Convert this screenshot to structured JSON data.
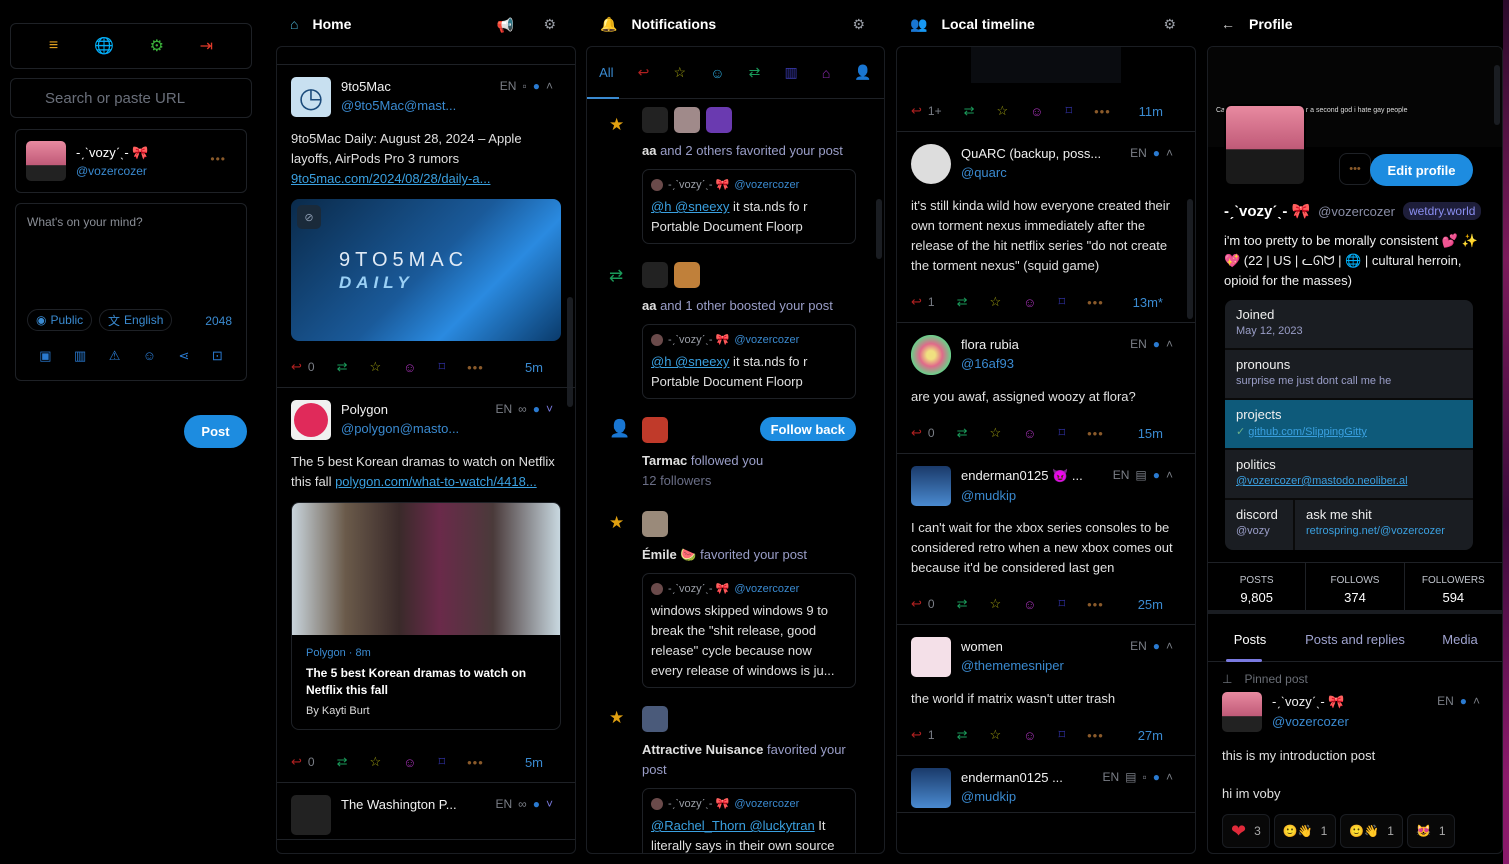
{
  "sidebar": {
    "nav_icons": [
      "menu-icon",
      "globe-icon",
      "settings-icon",
      "logout-icon"
    ],
    "search_placeholder": "Search or paste URL",
    "account": {
      "display_name": "-ˏˋvozyˊˎ- 🎀",
      "handle": "@vozercozer"
    },
    "compose": {
      "placeholder": "What's on your mind?",
      "visibility": "Public",
      "language": "English",
      "char_count": "2048",
      "tool_icons": [
        "media-icon",
        "poll-icon",
        "content-warning-icon",
        "emoji-icon",
        "share-icon",
        "schedule-icon"
      ],
      "post_label": "Post"
    }
  },
  "home": {
    "title": "Home",
    "statuses": [
      {
        "name": "9to5Mac",
        "handle": "@9to5Mac@mast...",
        "lang": "EN",
        "body": "9to5Mac Daily: August 28, 2024 – Apple layoffs, AirPods Pro 3 rumors ",
        "link": "9to5mac.com/2024/08/28/daily-a...",
        "media_title": "9TO5MAC",
        "media_sub": "DAILY",
        "replies": "0",
        "time": "5m"
      },
      {
        "name": "Polygon",
        "handle": "@polygon@masto...",
        "lang": "EN",
        "body": "The 5 best Korean dramas to watch on Netflix this fall ",
        "link": "polygon.com/what-to-watch/4418...",
        "card_source": "Polygon · 8m",
        "card_title": "The 5 best Korean dramas to watch on Netflix this fall",
        "card_author": "By Kayti Burt",
        "replies": "0",
        "time": "5m"
      },
      {
        "name": "The Washington P...",
        "lang": "EN"
      }
    ]
  },
  "notifications": {
    "title": "Notifications",
    "tabs": [
      "All",
      "mentions",
      "favorites",
      "reactions",
      "boosts",
      "polls",
      "posts",
      "follows"
    ],
    "items": [
      {
        "kind": "favorite",
        "actor": "aa",
        "text": " and 2 others favorited your post",
        "quote_name": "-ˏˋvozyˊˎ- 🎀",
        "quote_handle": "@vozercozer",
        "quote_mentions": "@h @sneexy",
        "quote_body": " it sta.nds fo r Portable Document Floorp"
      },
      {
        "kind": "boost",
        "actor": "aa",
        "text": " and 1 other boosted your post",
        "quote_name": "-ˏˋvozyˊˎ- 🎀",
        "quote_handle": "@vozercozer",
        "quote_mentions": "@h @sneexy",
        "quote_body": " it sta.nds fo r Portable Document Floorp"
      },
      {
        "kind": "follow",
        "actor": "Tarmac",
        "text": " followed you",
        "followers": "12 followers",
        "button": "Follow back"
      },
      {
        "kind": "favorite",
        "actor": "Émile 🍉",
        "text": " favorited your post",
        "quote_name": "-ˏˋvozyˊˎ- 🎀",
        "quote_handle": "@vozercozer",
        "quote_body": "windows skipped windows 9 to break the \"shit release, good release\" cycle because now every release of windows is ju..."
      },
      {
        "kind": "favorite",
        "actor": "Attractive Nuisance",
        "text": " favorited your post",
        "quote_name": "-ˏˋvozyˊˎ- 🎀",
        "quote_handle": "@vozercozer",
        "quote_mentions": "@Rachel_Thorn @luckytran",
        "quote_body": " It literally says in their own source"
      }
    ]
  },
  "local": {
    "title": "Local timeline",
    "first_actions": {
      "replies": "1+",
      "time": "11m"
    },
    "statuses": [
      {
        "name": "QuARC (backup, poss...",
        "handle": "@quarc",
        "lang": "EN",
        "body": "it's still kinda wild how everyone created their own torment nexus immediately after the release of the hit netflix series \"do not create the torment nexus\" (squid game)",
        "replies": "1",
        "time": "13m*"
      },
      {
        "name": "flora rubia",
        "handle": "@16af93",
        "lang": "EN",
        "body": "are you awaf, assigned woozy at flora?",
        "replies": "0",
        "time": "15m"
      },
      {
        "name": "enderman0125 😈 ...",
        "handle": "@mudkip",
        "lang": "EN",
        "body": "I can't wait for the xbox series consoles to be considered retro when a new xbox comes out because it'd be considered last gen",
        "replies": "0",
        "time": "25m"
      },
      {
        "name": "women",
        "handle": "@thememesniper",
        "lang": "EN",
        "body": "the world if matrix  wasn't utter trash",
        "replies": "1",
        "time": "27m"
      },
      {
        "name": "enderman0125 ...",
        "handle": "@mudkip",
        "lang": "EN"
      }
    ]
  },
  "profile": {
    "title": "Profile",
    "banner_text": "Can you people be normal for a second god i hate gay people",
    "display_name": "-ˏˋvozyˊˎ- 🎀",
    "handle": "@vozercozer",
    "instance": "wetdry.world",
    "edit_label": "Edit profile",
    "bio": "i'm too pretty to be morally consistent 💕 ✨💖 (22 | US | ᓚᘏᗢ | 🌐 | cultural herroin, opioid for the masses)",
    "fields": [
      {
        "key": "Joined",
        "value": "May 12, 2023"
      },
      {
        "key": "pronouns",
        "value": "surprise me just dont call me he"
      },
      {
        "key": "projects",
        "value": "github.com/SlippingGitty",
        "verified": true
      },
      {
        "key": "politics",
        "value": "@vozercozer@mastodo.neoliber.al"
      },
      {
        "key": "discord",
        "value": "@vozy"
      },
      {
        "key": "ask me shit",
        "value": "retrospring.net/@vozercozer"
      }
    ],
    "stats": [
      {
        "label": "POSTS",
        "value": "9,805"
      },
      {
        "label": "FOLLOWS",
        "value": "374"
      },
      {
        "label": "FOLLOWERS",
        "value": "594"
      }
    ],
    "tabs": [
      "Posts",
      "Posts and replies",
      "Media"
    ],
    "pinned_label": "Pinned post",
    "pinned": {
      "name": "-ˏˋvozyˊˎ- 🎀",
      "handle": "@vozercozer",
      "lang": "EN",
      "body1": "this is my introduction post",
      "body2": "hi im voby",
      "reactions": [
        {
          "emoji": "❤",
          "count": "3"
        },
        {
          "emoji": "🙂👋",
          "count": "1"
        },
        {
          "emoji": "🙂👋",
          "count": "1"
        },
        {
          "emoji": "😻",
          "count": "1"
        }
      ]
    }
  }
}
